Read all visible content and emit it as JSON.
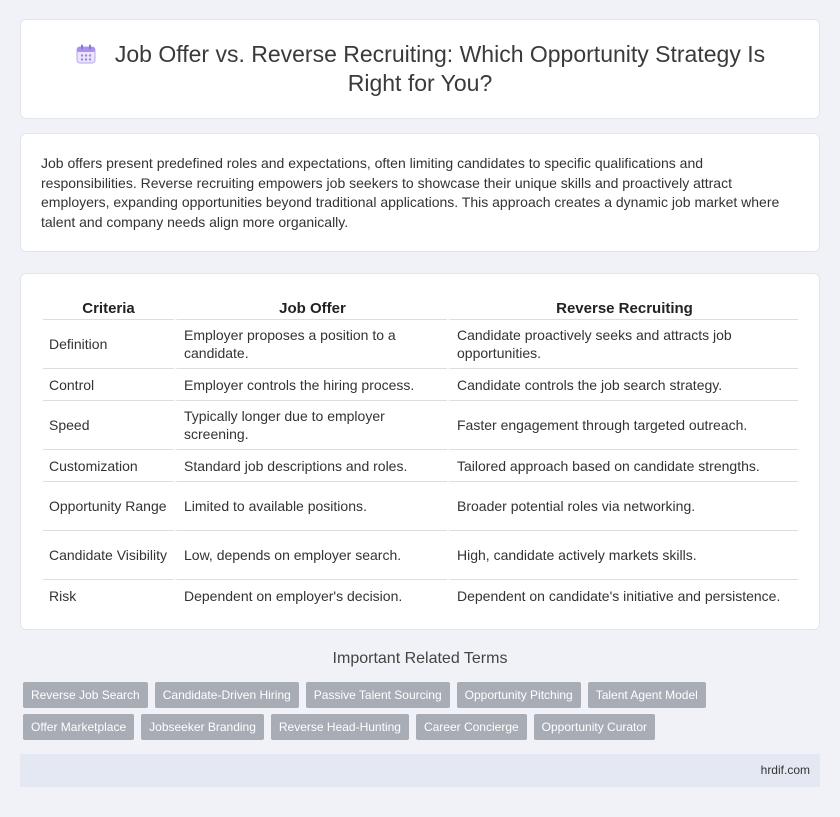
{
  "header": {
    "title": "Job Offer vs. Reverse Recruiting: Which Opportunity Strategy Is Right for You?",
    "icon": "calendar-icon"
  },
  "intro": {
    "text": "Job offers present predefined roles and expectations, often limiting candidates to specific qualifications and responsibilities. Reverse recruiting empowers job seekers to showcase their unique skills and proactively attract employers, expanding opportunities beyond traditional applications. This approach creates a dynamic job market where talent and company needs align more organically."
  },
  "table": {
    "headers": [
      "Criteria",
      "Job Offer",
      "Reverse Recruiting"
    ],
    "rows": [
      [
        "Definition",
        "Employer proposes a position to a candidate.",
        "Candidate proactively seeks and attracts job opportunities."
      ],
      [
        "Control",
        "Employer controls the hiring process.",
        "Candidate controls the job search strategy."
      ],
      [
        "Speed",
        "Typically longer due to employer screening.",
        "Faster engagement through targeted outreach."
      ],
      [
        "Customization",
        "Standard job descriptions and roles.",
        "Tailored approach based on candidate strengths."
      ],
      [
        "Opportunity Range",
        "Limited to available positions.",
        "Broader potential roles via networking."
      ],
      [
        "Candidate Visibility",
        "Low, depends on employer search.",
        "High, candidate actively markets skills."
      ],
      [
        "Risk",
        "Dependent on employer's decision.",
        "Dependent on candidate's initiative and persistence."
      ]
    ]
  },
  "related": {
    "title": "Important Related Terms",
    "tags": [
      "Reverse Job Search",
      "Candidate-Driven Hiring",
      "Passive Talent Sourcing",
      "Opportunity Pitching",
      "Talent Agent Model",
      "Offer Marketplace",
      "Jobseeker Branding",
      "Reverse Head-Hunting",
      "Career Concierge",
      "Opportunity Curator"
    ]
  },
  "footer": {
    "site": "hrdif.com"
  },
  "colors": {
    "background": "#f0f2f7",
    "tag": "#a7acb5",
    "footer": "#e3e8f3"
  }
}
